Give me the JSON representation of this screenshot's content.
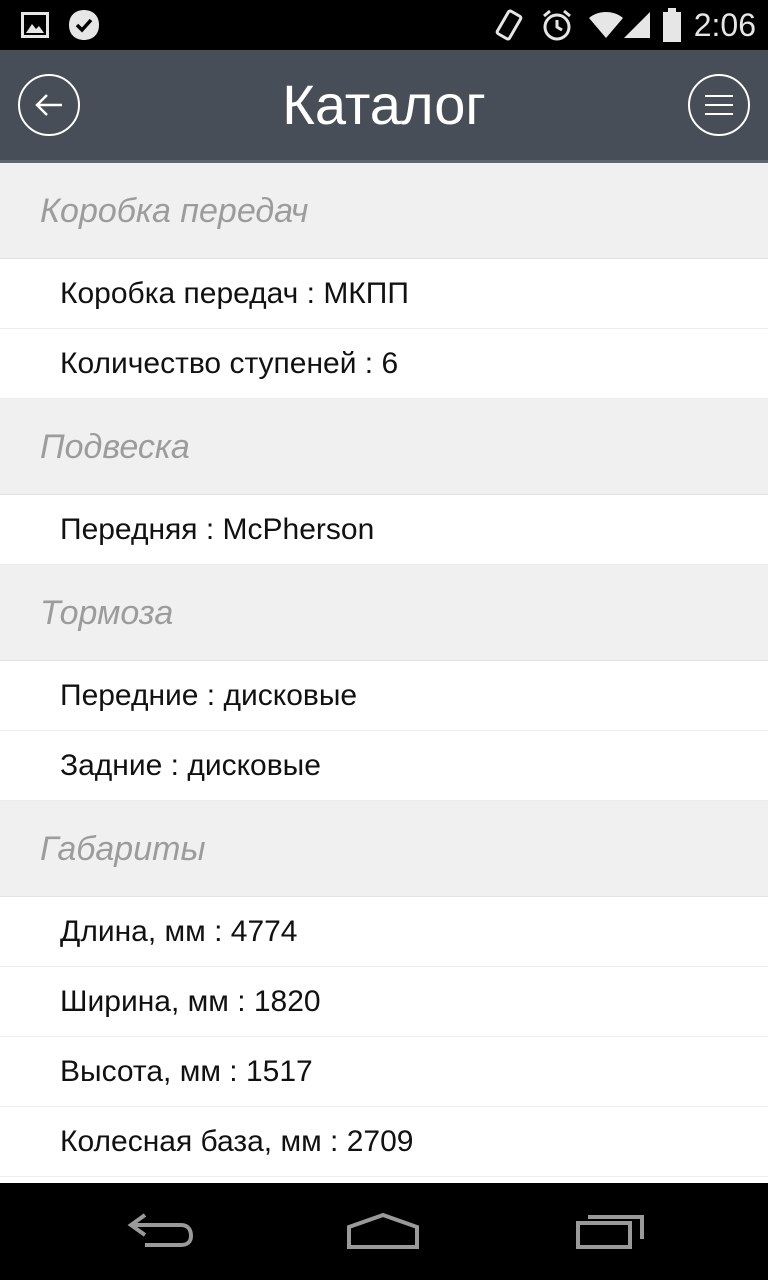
{
  "status_bar": {
    "time": "2:06",
    "icons": [
      "gallery-icon",
      "checkmark-badge-icon",
      "vibrate-icon",
      "alarm-icon",
      "wifi-icon",
      "signal-icon",
      "battery-icon"
    ]
  },
  "header": {
    "title": "Каталог",
    "back_icon": "arrow-left-icon",
    "menu_icon": "hamburger-menu-icon"
  },
  "sections": [
    {
      "title": "Коробка передач",
      "rows": [
        "Коробка передач : МКПП",
        "Количество ступеней : 6"
      ]
    },
    {
      "title": "Подвеска",
      "rows": [
        "Передняя : McPherson"
      ]
    },
    {
      "title": "Тормоза",
      "rows": [
        "Передние : дисковые",
        "Задние : дисковые"
      ]
    },
    {
      "title": "Габариты",
      "rows": [
        "Длина, мм : 4774",
        "Ширина, мм : 1820",
        "Высота, мм : 1517",
        "Колесная база, мм : 2709"
      ]
    }
  ],
  "nav_bar": {
    "icons": [
      "back-nav-icon",
      "home-nav-icon",
      "recent-apps-icon"
    ]
  },
  "colors": {
    "header_bg": "#474e58",
    "section_bg": "#f0f0f0",
    "section_text": "#9c9c9c",
    "row_text": "#111111"
  }
}
